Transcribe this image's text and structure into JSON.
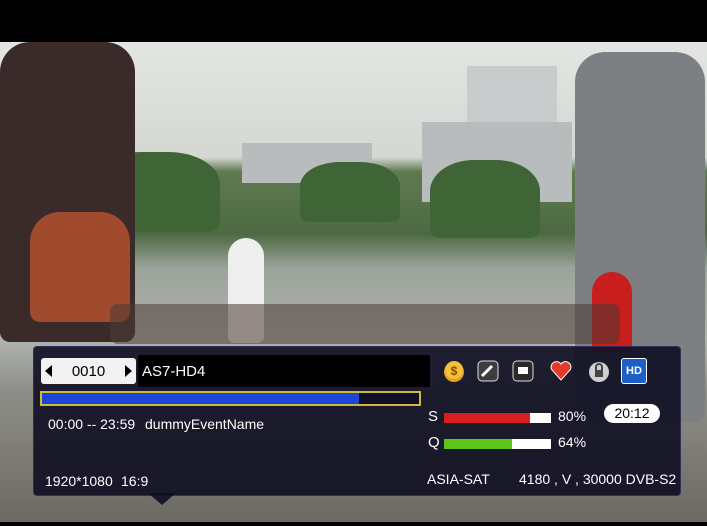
{
  "channel": {
    "number": "0010",
    "name": "AS7-HD4"
  },
  "event": {
    "time": "00:00 -- 23:59",
    "name": "dummyEventName",
    "progress": 0.84
  },
  "signal": {
    "s_label": "S",
    "s_value": "80%",
    "s_level": 0.8,
    "s_color": "#d81e1e",
    "q_label": "Q",
    "q_value": "64%",
    "q_level": 0.64,
    "q_color": "#5ec41c"
  },
  "clock": "20:12",
  "video": {
    "resolution": "1920*1080",
    "aspect": "16:9"
  },
  "satellite": {
    "name": "ASIA-SAT",
    "tp": "4180 , V , 30000 DVB-S2"
  },
  "icons": [
    {
      "name": "coin-icon"
    },
    {
      "name": "subtitle-icon"
    },
    {
      "name": "teletext-icon"
    },
    {
      "name": "favorite-icon"
    },
    {
      "name": "lock-icon"
    },
    {
      "name": "hd-icon",
      "label": "HD"
    }
  ]
}
